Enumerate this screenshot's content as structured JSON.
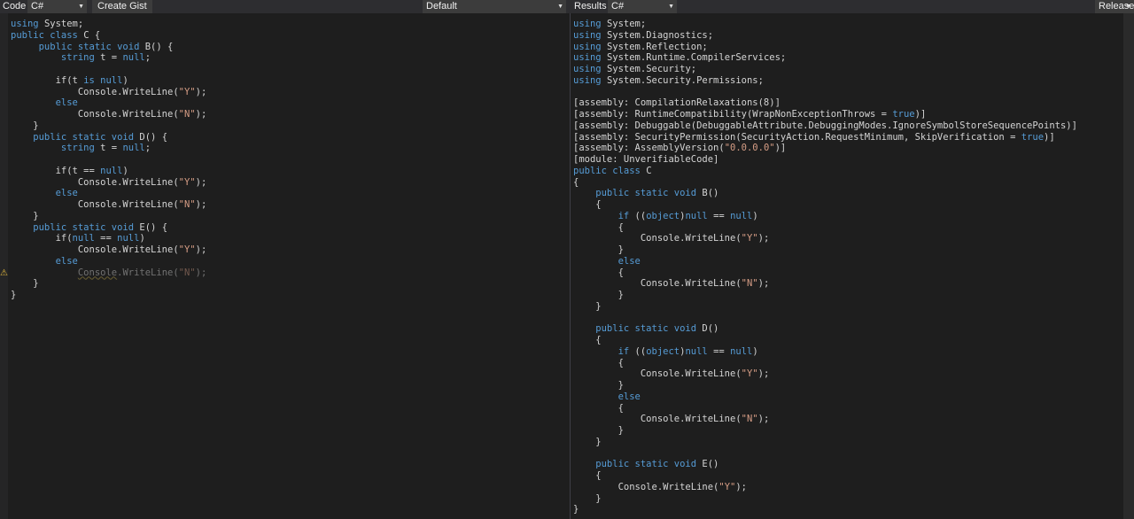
{
  "toolbar": {
    "code_label": "Code",
    "language": "C#",
    "create_gist": "Create Gist",
    "target": "Default",
    "results_label": "Results",
    "output_language": "C#",
    "build_mode": "Release"
  },
  "editor": {
    "lines": [
      [
        {
          "t": "using ",
          "k": true
        },
        {
          "t": "System;"
        }
      ],
      [
        {
          "t": "public class ",
          "k": true
        },
        {
          "t": "C {"
        }
      ],
      [
        {
          "t": "     public static void ",
          "k": true
        },
        {
          "t": "B() {"
        }
      ],
      [
        {
          "t": "         string ",
          "k": true
        },
        {
          "t": "t = "
        },
        {
          "t": "null",
          "k": true
        },
        {
          "t": ";"
        }
      ],
      [],
      [
        {
          "t": "        if(t "
        },
        {
          "t": "is null",
          "k": true
        },
        {
          "t": ")"
        }
      ],
      [
        {
          "t": "            Console.WriteLine("
        },
        {
          "t": "\"Y\"",
          "s": true
        },
        {
          "t": ");"
        }
      ],
      [
        {
          "t": "        else",
          "k": true
        }
      ],
      [
        {
          "t": "            Console.WriteLine("
        },
        {
          "t": "\"N\"",
          "s": true
        },
        {
          "t": ");"
        }
      ],
      [
        {
          "t": "    }"
        }
      ],
      [
        {
          "t": "    public static void ",
          "k": true
        },
        {
          "t": "D() {"
        }
      ],
      [
        {
          "t": "         string ",
          "k": true
        },
        {
          "t": "t = "
        },
        {
          "t": "null",
          "k": true
        },
        {
          "t": ";"
        }
      ],
      [],
      [
        {
          "t": "        if(t == "
        },
        {
          "t": "null",
          "k": true
        },
        {
          "t": ")"
        }
      ],
      [
        {
          "t": "            Console.WriteLine("
        },
        {
          "t": "\"Y\"",
          "s": true
        },
        {
          "t": ");"
        }
      ],
      [
        {
          "t": "        else",
          "k": true
        }
      ],
      [
        {
          "t": "            Console.WriteLine("
        },
        {
          "t": "\"N\"",
          "s": true
        },
        {
          "t": ");"
        }
      ],
      [
        {
          "t": "    }"
        }
      ],
      [
        {
          "t": "    public static void ",
          "k": true
        },
        {
          "t": "E() {"
        }
      ],
      [
        {
          "t": "        if("
        },
        {
          "t": "null",
          "k": true
        },
        {
          "t": " == "
        },
        {
          "t": "null",
          "k": true
        },
        {
          "t": ")"
        }
      ],
      [
        {
          "t": "            Console.WriteLine("
        },
        {
          "t": "\"Y\"",
          "s": true
        },
        {
          "t": ");"
        }
      ],
      [
        {
          "t": "        else",
          "k": true
        }
      ],
      [
        {
          "t": "            "
        },
        {
          "t": "Console",
          "d": true,
          "w": true
        },
        {
          "t": ".WriteLine(",
          "d": true
        },
        {
          "t": "\"N\"",
          "s": true,
          "d": true
        },
        {
          "t": ");",
          "d": true
        }
      ],
      [
        {
          "t": "    }"
        }
      ],
      [
        {
          "t": "}"
        }
      ]
    ]
  },
  "results": {
    "lines": [
      [
        {
          "t": "using ",
          "k": true
        },
        {
          "t": "System;"
        }
      ],
      [
        {
          "t": "using ",
          "k": true
        },
        {
          "t": "System.Diagnostics;"
        }
      ],
      [
        {
          "t": "using ",
          "k": true
        },
        {
          "t": "System.Reflection;"
        }
      ],
      [
        {
          "t": "using ",
          "k": true
        },
        {
          "t": "System.Runtime.CompilerServices;"
        }
      ],
      [
        {
          "t": "using ",
          "k": true
        },
        {
          "t": "System.Security;"
        }
      ],
      [
        {
          "t": "using ",
          "k": true
        },
        {
          "t": "System.Security.Permissions;"
        }
      ],
      [],
      [
        {
          "t": "[assembly: CompilationRelaxations(8)]"
        }
      ],
      [
        {
          "t": "[assembly: RuntimeCompatibility(WrapNonExceptionThrows = "
        },
        {
          "t": "true",
          "k": true
        },
        {
          "t": ")]"
        }
      ],
      [
        {
          "t": "[assembly: Debuggable(DebuggableAttribute.DebuggingModes.IgnoreSymbolStoreSequencePoints)]"
        }
      ],
      [
        {
          "t": "[assembly: SecurityPermission(SecurityAction.RequestMinimum, SkipVerification = "
        },
        {
          "t": "true",
          "k": true
        },
        {
          "t": ")]"
        }
      ],
      [
        {
          "t": "[assembly: AssemblyVersion("
        },
        {
          "t": "\"0.0.0.0\"",
          "s": true
        },
        {
          "t": ")]"
        }
      ],
      [
        {
          "t": "[module: UnverifiableCode]"
        }
      ],
      [
        {
          "t": "public class ",
          "k": true
        },
        {
          "t": "C"
        }
      ],
      [
        {
          "t": "{"
        }
      ],
      [
        {
          "t": "    public static void ",
          "k": true
        },
        {
          "t": "B()"
        }
      ],
      [
        {
          "t": "    {"
        }
      ],
      [
        {
          "t": "        if ",
          "k": true
        },
        {
          "t": "(("
        },
        {
          "t": "object",
          "k": true
        },
        {
          "t": ")"
        },
        {
          "t": "null",
          "k": true
        },
        {
          "t": " == "
        },
        {
          "t": "null",
          "k": true
        },
        {
          "t": ")"
        }
      ],
      [
        {
          "t": "        {"
        }
      ],
      [
        {
          "t": "            Console.WriteLine("
        },
        {
          "t": "\"Y\"",
          "s": true
        },
        {
          "t": ");"
        }
      ],
      [
        {
          "t": "        }"
        }
      ],
      [
        {
          "t": "        else",
          "k": true
        }
      ],
      [
        {
          "t": "        {"
        }
      ],
      [
        {
          "t": "            Console.WriteLine("
        },
        {
          "t": "\"N\"",
          "s": true
        },
        {
          "t": ");"
        }
      ],
      [
        {
          "t": "        }"
        }
      ],
      [
        {
          "t": "    }"
        }
      ],
      [],
      [
        {
          "t": "    public static void ",
          "k": true
        },
        {
          "t": "D()"
        }
      ],
      [
        {
          "t": "    {"
        }
      ],
      [
        {
          "t": "        if ",
          "k": true
        },
        {
          "t": "(("
        },
        {
          "t": "object",
          "k": true
        },
        {
          "t": ")"
        },
        {
          "t": "null",
          "k": true
        },
        {
          "t": " == "
        },
        {
          "t": "null",
          "k": true
        },
        {
          "t": ")"
        }
      ],
      [
        {
          "t": "        {"
        }
      ],
      [
        {
          "t": "            Console.WriteLine("
        },
        {
          "t": "\"Y\"",
          "s": true
        },
        {
          "t": ");"
        }
      ],
      [
        {
          "t": "        }"
        }
      ],
      [
        {
          "t": "        else",
          "k": true
        }
      ],
      [
        {
          "t": "        {"
        }
      ],
      [
        {
          "t": "            Console.WriteLine("
        },
        {
          "t": "\"N\"",
          "s": true
        },
        {
          "t": ");"
        }
      ],
      [
        {
          "t": "        }"
        }
      ],
      [
        {
          "t": "    }"
        }
      ],
      [],
      [
        {
          "t": "    public static void ",
          "k": true
        },
        {
          "t": "E()"
        }
      ],
      [
        {
          "t": "    {"
        }
      ],
      [
        {
          "t": "        Console.WriteLine("
        },
        {
          "t": "\"Y\"",
          "s": true
        },
        {
          "t": ");"
        }
      ],
      [
        {
          "t": "    }"
        }
      ],
      [
        {
          "t": "}"
        }
      ]
    ]
  },
  "icons": {
    "warning": "warning-icon",
    "caret": "chevron-down-icon"
  },
  "colors": {
    "background": "#1e1e1e",
    "keyword": "#569cd6",
    "string": "#d69d85",
    "text": "#d4d4d4",
    "warning": "#e2b93d"
  }
}
